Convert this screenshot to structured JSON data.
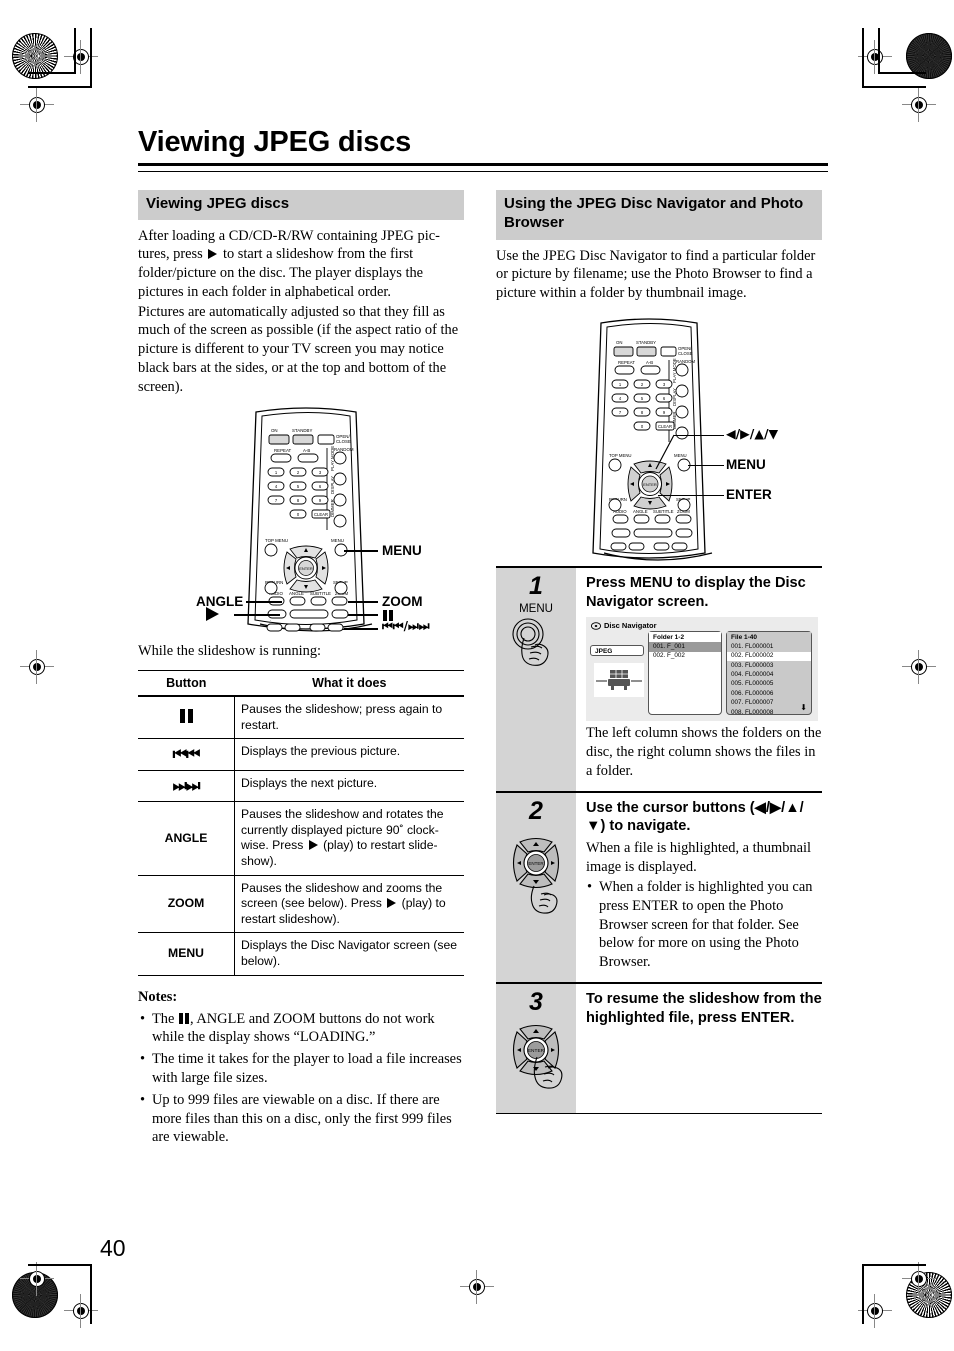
{
  "page": {
    "number": "40",
    "title": "Viewing JPEG discs"
  },
  "left_column": {
    "section_title": "Viewing JPEG discs",
    "para1_a": "After loading a CD/CD-R/RW containing JPEG pic-tures, press ",
    "para1_b": " to start a slideshow from the first folder/picture on the disc. The player displays the pictures in each folder in alphabetical order.",
    "para2": "Pictures are automatically adjusted so that they fill as much of the screen as possible (if the aspect ratio of the picture is different to your TV screen you may notice black bars at the sides, or at the top and bottom of the screen).",
    "remote_labels": {
      "menu": "MENU",
      "angle": "ANGLE",
      "zoom": "ZOOM",
      "play": "▶",
      "pause": "❙❙",
      "skip": "⏮⏭"
    },
    "table_intro": "While the slideshow is running:",
    "table": {
      "headers": [
        "Button",
        "What it does"
      ],
      "rows": [
        {
          "button": "❙❙",
          "button_type": "glyph-pause",
          "does": "Pauses the slideshow; press again to restart."
        },
        {
          "button": "⏮",
          "button_type": "glyph-prev",
          "does": "Displays the previous picture."
        },
        {
          "button": "⏭",
          "button_type": "glyph-next",
          "does": "Displays the next picture."
        },
        {
          "button": "ANGLE",
          "button_type": "text",
          "does_a": "Pauses the slideshow and rotates the currently displayed picture 90˚ clock-wise. Press ",
          "does_b": " (play) to restart slide-show)."
        },
        {
          "button": "ZOOM",
          "button_type": "text",
          "does_a": "Pauses the slideshow and zooms the screen (see below). Press ",
          "does_b": " (play) to restart slideshow)."
        },
        {
          "button": "MENU",
          "button_type": "text",
          "does": "Displays the Disc Navigator screen (see below)."
        }
      ]
    },
    "notes_heading": "Notes:",
    "notes": [
      {
        "a": "The ",
        "b": ", ANGLE and ZOOM buttons do not work while the display shows “LOADING.”"
      },
      {
        "a": "The time it takes for the player to load a file increases with large file sizes."
      },
      {
        "a": "Up to 999 files are viewable on a disc. If there are more files than this on a disc, only the first 999 files are viewable."
      }
    ]
  },
  "right_column": {
    "section_title": "Using the JPEG Disc Navigator and Photo Browser",
    "intro": "Use the JPEG Disc Navigator to find a particular folder or picture by filename; use the Photo Browser to find a picture within a folder by thumbnail image.",
    "remote_labels": {
      "cursor": "◀/▶/▲/▼",
      "menu": "MENU",
      "enter": "ENTER"
    },
    "steps": [
      {
        "num": "1",
        "icon_label": "MENU",
        "title": "Press MENU to display the Disc Navigator screen.",
        "after": "The left column shows the folders on the disc, the right column shows the files in a folder."
      },
      {
        "num": "2",
        "title": "Use the cursor buttons (◀/▶/▲/▼) to navigate.",
        "after": "When a file is highlighted, a thumbnail image is displayed.",
        "bullets": [
          "When a folder is highlighted you can press ENTER to open the Photo Browser screen for that folder. See below for more on using the Photo Browser."
        ]
      },
      {
        "num": "3",
        "title": "To resume the slideshow from the highlighted file, press ENTER."
      }
    ],
    "disc_navigator": {
      "window_title": "Disc Navigator",
      "disc_tab": "JPEG",
      "folder_header": "Folder 1-2",
      "folders": [
        {
          "label": "001. F_001",
          "selected": true
        },
        {
          "label": "002. F_002",
          "selected": false
        }
      ],
      "file_header": "File 1-40",
      "files": [
        {
          "label": "001. FL000001",
          "selected": false
        },
        {
          "label": "002. FL000002",
          "selected": true
        },
        {
          "label": "003. FL000003",
          "selected": false
        },
        {
          "label": "004. FL000004",
          "selected": false
        },
        {
          "label": "005. FL000005",
          "selected": false
        },
        {
          "label": "006. FL000006",
          "selected": false
        },
        {
          "label": "007. FL000007",
          "selected": false
        },
        {
          "label": "008. FL000008",
          "selected": false
        }
      ],
      "scroll_arrow": "⬇"
    }
  },
  "remote_keys": {
    "on": "ON",
    "standby": "STANDBY",
    "open_close": "OPEN/CLOSE",
    "repeat": "REPEAT",
    "ab": "A-B",
    "random": "RANDOM",
    "play_mode": "PLAY MODE",
    "display": "DISPLAY",
    "dimmer": "DIMMER",
    "top_menu": "TOP MENU",
    "menu": "MENU",
    "return": "RETURN",
    "setup": "SETUP",
    "enter": "ENTER",
    "audio": "AUDIO",
    "angle": "ANGLE",
    "subtitle": "SUBTITLE",
    "zoom": "ZOOM",
    "clear": "CLEAR",
    "numbers": [
      "1",
      "2",
      "3",
      "4",
      "5",
      "6",
      "7",
      "8",
      "9",
      "0"
    ]
  },
  "colors": {
    "section_bar": "#cccccc",
    "step_panel": "#d4d4d4",
    "screen_bg": "#ebebeb",
    "file_panel": "#c9c9c9"
  }
}
